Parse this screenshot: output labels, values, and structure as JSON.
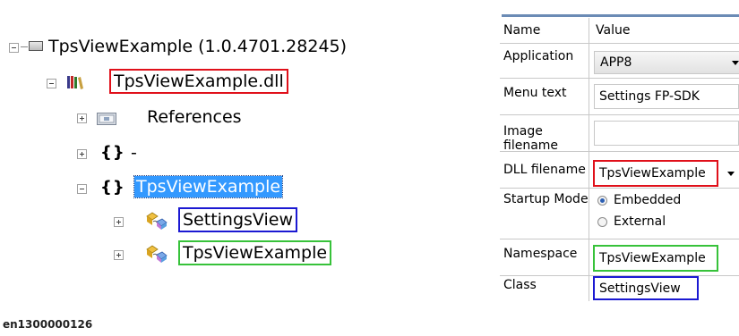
{
  "tree": {
    "root_label": "TpsViewExample (1.0.4701.28245)",
    "dll_label": "TpsViewExample.dll",
    "references_label": "References",
    "namespace_dash_braces": "{}",
    "namespace_dash_label": "-",
    "namespace_main_braces": "{}",
    "namespace_main_label": "TpsViewExample",
    "class_settings_label": "SettingsView",
    "class_tpsview_label": "TpsViewExample"
  },
  "properties": {
    "header_name": "Name",
    "header_value": "Value",
    "rows": [
      {
        "name": "Application",
        "value": "APP8"
      },
      {
        "name": "Menu text",
        "value": "Settings FP-SDK"
      },
      {
        "name": "Image filename",
        "value": ""
      },
      {
        "name": "DLL filename",
        "value": "TpsViewExample"
      },
      {
        "name": "Startup Mode",
        "options": [
          "Embedded",
          "External"
        ],
        "selected": "Embedded"
      },
      {
        "name": "Namespace",
        "value": "TpsViewExample"
      },
      {
        "name": "Class",
        "value": "SettingsView"
      }
    ]
  },
  "caption": "en1300000126",
  "colors": {
    "highlight_red": "#e0101a",
    "highlight_blue": "#1b19d2",
    "highlight_green": "#37c23a",
    "selection": "#3399ff"
  }
}
